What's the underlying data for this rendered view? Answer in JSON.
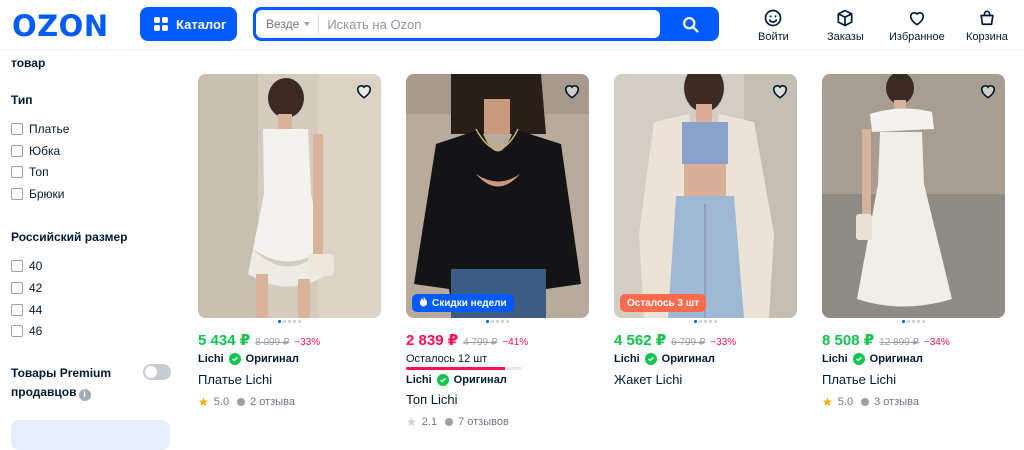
{
  "header": {
    "logo": "OZON",
    "catalog_label": "Каталог",
    "search_scope": "Везде",
    "search_placeholder": "Искать на Ozon",
    "nav": [
      {
        "label": "Войти",
        "icon": "smile-icon"
      },
      {
        "label": "Заказы",
        "icon": "box-icon"
      },
      {
        "label": "Избранное",
        "icon": "heart-icon"
      },
      {
        "label": "Корзина",
        "icon": "cart-icon"
      }
    ]
  },
  "sidebar": {
    "cut_heading": "товар",
    "type_heading": "Тип",
    "types": [
      "Платье",
      "Юбка",
      "Топ",
      "Брюки"
    ],
    "size_heading": "Российский размер",
    "sizes": [
      "40",
      "42",
      "44",
      "46"
    ],
    "premium_label": "Товары Premium продавцов",
    "premium_enabled": false
  },
  "products": [
    {
      "price": "5 434 ₽",
      "old_price": "8 099 ₽",
      "discount": "−33%",
      "price_color": "green",
      "active_dot": 0,
      "seller": "Lichi",
      "seller_badge": "Оригинал",
      "title": "Платье Lichi",
      "rating": "5.0",
      "reviews": "2 отзыва",
      "image": "white-mini-dress"
    },
    {
      "price": "2 839 ₽",
      "old_price": "4 799 ₽",
      "discount": "−41%",
      "price_color": "red",
      "active_dot": 0,
      "badge": "Скидки недели",
      "badge_color": "#005bff",
      "stock_text": "Осталось 12 шт",
      "stock_level": 0.85,
      "seller": "Lichi",
      "seller_badge": "Оригинал",
      "title": "Топ Lichi",
      "rating": "2.1",
      "reviews": "7 отзывов",
      "image": "black-top"
    },
    {
      "price": "4 562 ₽",
      "old_price": "6 799 ₽",
      "discount": "−33%",
      "price_color": "green",
      "active_dot": 0,
      "badge": "Осталось 3 шт",
      "badge_color": "#ff6a4d",
      "seller": "Lichi",
      "seller_badge": "Оригинал",
      "title": "Жакет Lichi",
      "image": "beige-blazer"
    },
    {
      "price": "8 508 ₽",
      "old_price": "12 899 ₽",
      "discount": "−34%",
      "price_color": "green",
      "active_dot": 0,
      "seller": "Lichi",
      "seller_badge": "Оригинал",
      "title": "Платье Lichi",
      "rating": "5.0",
      "reviews": "3 отзыва",
      "image": "white-maxi-dress"
    }
  ],
  "colors": {
    "brand": "#005bff",
    "price_green": "#10c44c",
    "price_red": "#f91155",
    "text": "#001a34"
  }
}
